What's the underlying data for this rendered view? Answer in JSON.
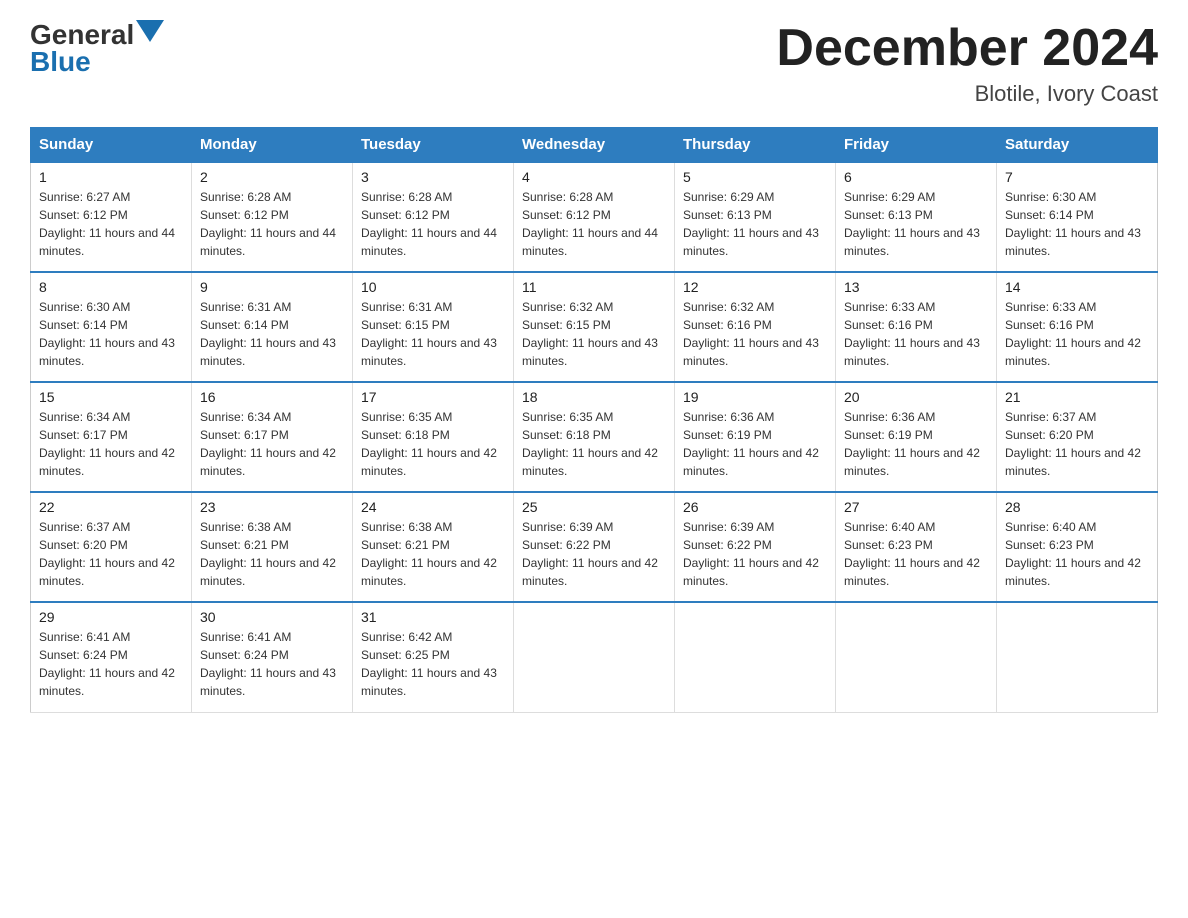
{
  "logo": {
    "general": "General",
    "blue": "Blue"
  },
  "title": "December 2024",
  "subtitle": "Blotile, Ivory Coast",
  "days_of_week": [
    "Sunday",
    "Monday",
    "Tuesday",
    "Wednesday",
    "Thursday",
    "Friday",
    "Saturday"
  ],
  "weeks": [
    [
      {
        "day": "1",
        "sunrise": "6:27 AM",
        "sunset": "6:12 PM",
        "daylight": "11 hours and 44 minutes."
      },
      {
        "day": "2",
        "sunrise": "6:28 AM",
        "sunset": "6:12 PM",
        "daylight": "11 hours and 44 minutes."
      },
      {
        "day": "3",
        "sunrise": "6:28 AM",
        "sunset": "6:12 PM",
        "daylight": "11 hours and 44 minutes."
      },
      {
        "day": "4",
        "sunrise": "6:28 AM",
        "sunset": "6:12 PM",
        "daylight": "11 hours and 44 minutes."
      },
      {
        "day": "5",
        "sunrise": "6:29 AM",
        "sunset": "6:13 PM",
        "daylight": "11 hours and 43 minutes."
      },
      {
        "day": "6",
        "sunrise": "6:29 AM",
        "sunset": "6:13 PM",
        "daylight": "11 hours and 43 minutes."
      },
      {
        "day": "7",
        "sunrise": "6:30 AM",
        "sunset": "6:14 PM",
        "daylight": "11 hours and 43 minutes."
      }
    ],
    [
      {
        "day": "8",
        "sunrise": "6:30 AM",
        "sunset": "6:14 PM",
        "daylight": "11 hours and 43 minutes."
      },
      {
        "day": "9",
        "sunrise": "6:31 AM",
        "sunset": "6:14 PM",
        "daylight": "11 hours and 43 minutes."
      },
      {
        "day": "10",
        "sunrise": "6:31 AM",
        "sunset": "6:15 PM",
        "daylight": "11 hours and 43 minutes."
      },
      {
        "day": "11",
        "sunrise": "6:32 AM",
        "sunset": "6:15 PM",
        "daylight": "11 hours and 43 minutes."
      },
      {
        "day": "12",
        "sunrise": "6:32 AM",
        "sunset": "6:16 PM",
        "daylight": "11 hours and 43 minutes."
      },
      {
        "day": "13",
        "sunrise": "6:33 AM",
        "sunset": "6:16 PM",
        "daylight": "11 hours and 43 minutes."
      },
      {
        "day": "14",
        "sunrise": "6:33 AM",
        "sunset": "6:16 PM",
        "daylight": "11 hours and 42 minutes."
      }
    ],
    [
      {
        "day": "15",
        "sunrise": "6:34 AM",
        "sunset": "6:17 PM",
        "daylight": "11 hours and 42 minutes."
      },
      {
        "day": "16",
        "sunrise": "6:34 AM",
        "sunset": "6:17 PM",
        "daylight": "11 hours and 42 minutes."
      },
      {
        "day": "17",
        "sunrise": "6:35 AM",
        "sunset": "6:18 PM",
        "daylight": "11 hours and 42 minutes."
      },
      {
        "day": "18",
        "sunrise": "6:35 AM",
        "sunset": "6:18 PM",
        "daylight": "11 hours and 42 minutes."
      },
      {
        "day": "19",
        "sunrise": "6:36 AM",
        "sunset": "6:19 PM",
        "daylight": "11 hours and 42 minutes."
      },
      {
        "day": "20",
        "sunrise": "6:36 AM",
        "sunset": "6:19 PM",
        "daylight": "11 hours and 42 minutes."
      },
      {
        "day": "21",
        "sunrise": "6:37 AM",
        "sunset": "6:20 PM",
        "daylight": "11 hours and 42 minutes."
      }
    ],
    [
      {
        "day": "22",
        "sunrise": "6:37 AM",
        "sunset": "6:20 PM",
        "daylight": "11 hours and 42 minutes."
      },
      {
        "day": "23",
        "sunrise": "6:38 AM",
        "sunset": "6:21 PM",
        "daylight": "11 hours and 42 minutes."
      },
      {
        "day": "24",
        "sunrise": "6:38 AM",
        "sunset": "6:21 PM",
        "daylight": "11 hours and 42 minutes."
      },
      {
        "day": "25",
        "sunrise": "6:39 AM",
        "sunset": "6:22 PM",
        "daylight": "11 hours and 42 minutes."
      },
      {
        "day": "26",
        "sunrise": "6:39 AM",
        "sunset": "6:22 PM",
        "daylight": "11 hours and 42 minutes."
      },
      {
        "day": "27",
        "sunrise": "6:40 AM",
        "sunset": "6:23 PM",
        "daylight": "11 hours and 42 minutes."
      },
      {
        "day": "28",
        "sunrise": "6:40 AM",
        "sunset": "6:23 PM",
        "daylight": "11 hours and 42 minutes."
      }
    ],
    [
      {
        "day": "29",
        "sunrise": "6:41 AM",
        "sunset": "6:24 PM",
        "daylight": "11 hours and 42 minutes."
      },
      {
        "day": "30",
        "sunrise": "6:41 AM",
        "sunset": "6:24 PM",
        "daylight": "11 hours and 43 minutes."
      },
      {
        "day": "31",
        "sunrise": "6:42 AM",
        "sunset": "6:25 PM",
        "daylight": "11 hours and 43 minutes."
      },
      null,
      null,
      null,
      null
    ]
  ]
}
